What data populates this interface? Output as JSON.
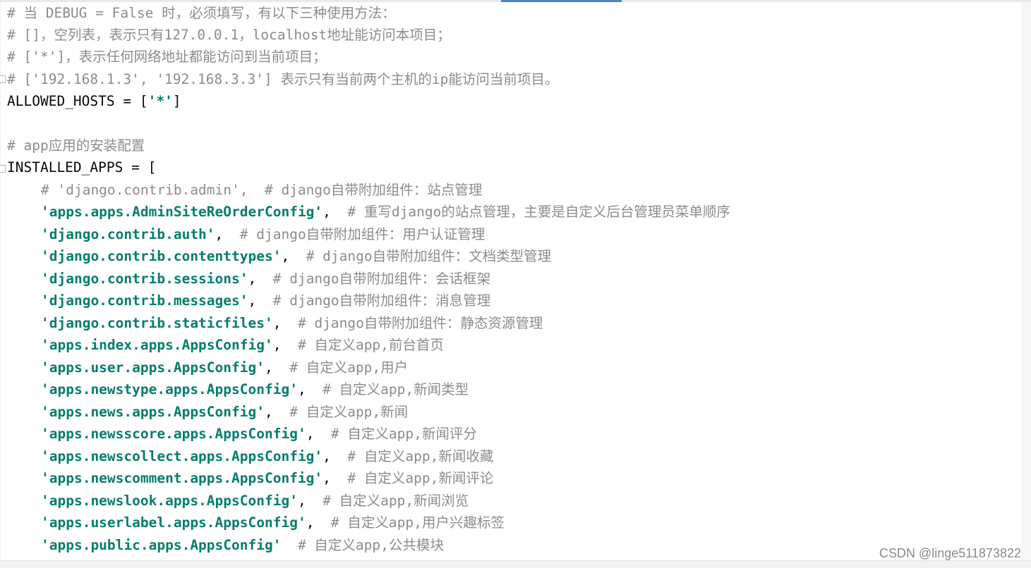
{
  "comments": {
    "c1": "# 当 DEBUG = False 时，必须填写，有以下三种使用方法：",
    "c2": "# []，空列表，表示只有127.0.0.1，localhost地址能访问本项目；",
    "c3": "# ['*']，表示任何网络地址都能访问到当前项目；",
    "c4": "# ['192.168.1.3', '192.168.3.3'] 表示只有当前两个主机的ip能访问当前项目。",
    "app_section": "# app应用的安装配置"
  },
  "allowed_hosts": {
    "prefix": "ALLOWED_HOSTS = [",
    "value": "'*'",
    "suffix": "]"
  },
  "installed_apps": {
    "open": "INSTALLED_APPS = [",
    "commented_entry": "# 'django.contrib.admin',  # django自带附加组件：站点管理",
    "entries": [
      {
        "str": "'apps.apps.AdminSiteReOrderConfig'",
        "sep": ",  ",
        "comment": "# 重写django的站点管理，主要是自定义后台管理员菜单顺序"
      },
      {
        "str": "'django.contrib.auth'",
        "sep": ",  ",
        "comment": "# django自带附加组件：用户认证管理"
      },
      {
        "str": "'django.contrib.contenttypes'",
        "sep": ",  ",
        "comment": "# django自带附加组件：文档类型管理"
      },
      {
        "str": "'django.contrib.sessions'",
        "sep": ",  ",
        "comment": "# django自带附加组件：会话框架"
      },
      {
        "str": "'django.contrib.messages'",
        "sep": ",  ",
        "comment": "# django自带附加组件：消息管理"
      },
      {
        "str": "'django.contrib.staticfiles'",
        "sep": ",  ",
        "comment": "# django自带附加组件：静态资源管理"
      },
      {
        "str": "'apps.index.apps.AppsConfig'",
        "sep": ",  ",
        "comment": "# 自定义app,前台首页"
      },
      {
        "str": "'apps.user.apps.AppsConfig'",
        "sep": ",  ",
        "comment": "# 自定义app,用户"
      },
      {
        "str": "'apps.newstype.apps.AppsConfig'",
        "sep": ",  ",
        "comment": "# 自定义app,新闻类型"
      },
      {
        "str": "'apps.news.apps.AppsConfig'",
        "sep": ",  ",
        "comment": "# 自定义app,新闻"
      },
      {
        "str": "'apps.newsscore.apps.AppsConfig'",
        "sep": ",  ",
        "comment": "# 自定义app,新闻评分"
      },
      {
        "str": "'apps.newscollect.apps.AppsConfig'",
        "sep": ",  ",
        "comment": "# 自定义app,新闻收藏"
      },
      {
        "str": "'apps.newscomment.apps.AppsConfig'",
        "sep": ",  ",
        "comment": "# 自定义app,新闻评论"
      },
      {
        "str": "'apps.newslook.apps.AppsConfig'",
        "sep": ",  ",
        "comment": "# 自定义app,新闻浏览"
      },
      {
        "str": "'apps.userlabel.apps.AppsConfig'",
        "sep": ",  ",
        "comment": "# 自定义app,用户兴趣标签"
      },
      {
        "str": "'apps.public.apps.AppsConfig'",
        "sep": "  ",
        "comment": "# 自定义app,公共模块"
      }
    ]
  },
  "watermark": "CSDN @linge511873822",
  "colors": {
    "comment": "#8c8c8c",
    "string": "#067d6e",
    "code": "#080808",
    "tab_indicator": "#4a86c8"
  }
}
